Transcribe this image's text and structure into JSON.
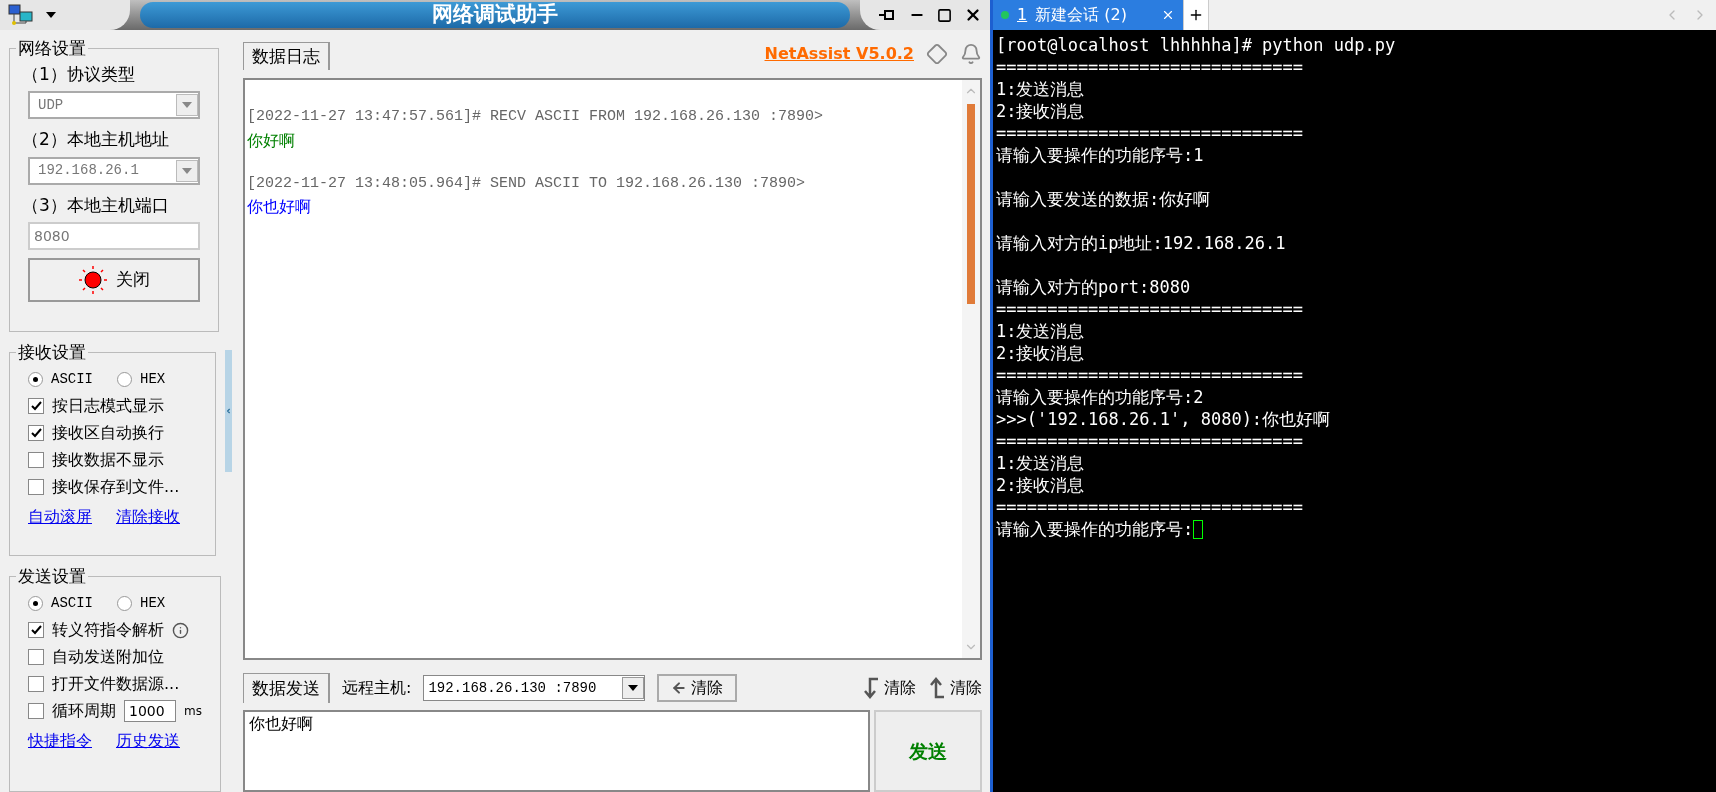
{
  "window": {
    "title": "网络调试助手"
  },
  "network_settings": {
    "title": "网络设置",
    "fields": [
      {
        "label": "（1）协议类型",
        "kind": "select",
        "value": "UDP",
        "disabled": true
      },
      {
        "label": "（2）本地主机地址",
        "kind": "select",
        "value": "192.168.26.1",
        "disabled": true
      },
      {
        "label": "（3）本地主机端口",
        "kind": "input",
        "value": "8080",
        "disabled": true
      }
    ],
    "connect_button": {
      "label": "关闭",
      "on": true
    }
  },
  "receive_settings": {
    "title": "接收设置",
    "encodings": [
      {
        "label": "ASCII",
        "selected": true
      },
      {
        "label": "HEX",
        "selected": false
      }
    ],
    "options": [
      {
        "label": "按日志模式显示",
        "checked": true,
        "kind": "plain"
      },
      {
        "label": "接收区自动换行",
        "checked": true,
        "kind": "plain"
      },
      {
        "label": "接收数据不显示",
        "checked": false,
        "kind": "plain"
      },
      {
        "label": "接收保存到文件...",
        "checked": false,
        "kind": "plain"
      }
    ],
    "links": [
      "自动滚屏",
      "清除接收"
    ]
  },
  "send_settings": {
    "title": "发送设置",
    "encodings": [
      {
        "label": "ASCII",
        "selected": true
      },
      {
        "label": "HEX",
        "selected": false
      }
    ],
    "options": [
      {
        "label": "转义符指令解析",
        "checked": true,
        "kind": "info"
      },
      {
        "label": "自动发送附加位",
        "checked": false,
        "kind": "plain"
      },
      {
        "label": "打开文件数据源...",
        "checked": false,
        "kind": "plain"
      },
      {
        "label": "循环周期",
        "checked": false,
        "kind": "period",
        "value": "1000",
        "unit": "ms"
      }
    ],
    "links": [
      "快捷指令",
      "历史发送"
    ]
  },
  "log": {
    "tab": "数据日志",
    "version_link": "NetAssist V5.0.2",
    "entries": [
      {
        "header": "[2022-11-27 13:47:57.561]# RECV ASCII FROM 192.168.26.130 :7890>",
        "message": "你好啊",
        "color": "#008000"
      },
      {
        "header": "[2022-11-27 13:48:05.964]# SEND ASCII TO 192.168.26.130 :7890>",
        "message": "你也好啊",
        "color": "#0000ff"
      }
    ]
  },
  "send": {
    "tab": "数据发送",
    "remote_label": "远程主机:",
    "remote_value": "192.168.26.130 :7890",
    "clear_button": "清除",
    "clear_left": "清除",
    "clear_right": "清除",
    "message": "你也好啊",
    "send_button": "发送"
  },
  "terminal": {
    "tabs": [
      {
        "number": "1",
        "title": "新建会话 (2)",
        "selected": true
      }
    ],
    "blocks": [
      [
        "[root@localhost lhhhhha]# python udp.py",
        "==============================",
        "1:发送消息",
        "2:接收消息",
        "==============================",
        "请输入要操作的功能序号:1"
      ],
      [
        "请输入要发送的数据:你好啊"
      ],
      [
        "请输入对方的ip地址:192.168.26.1"
      ],
      [
        "请输入对方的port:8080",
        "==============================",
        "1:发送消息",
        "2:接收消息",
        "==============================",
        "请输入要操作的功能序号:2",
        ">>>('192.168.26.1', 8080):你也好啊",
        "==============================",
        "1:发送消息",
        "2:接收消息",
        "==============================",
        "请输入要操作的功能序号:"
      ]
    ]
  }
}
